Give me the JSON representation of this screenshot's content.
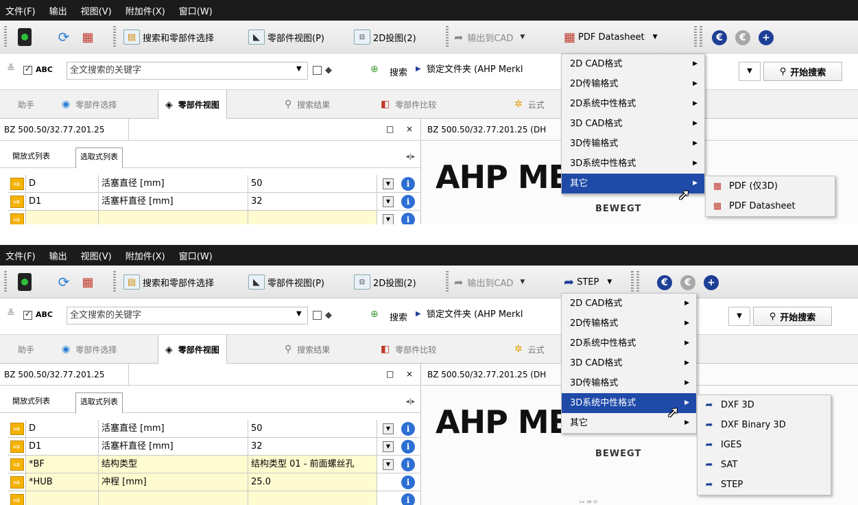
{
  "menubar": {
    "items": [
      "文件(F)",
      "输出",
      "视图(V)",
      "附加件(X)",
      "窗口(W)"
    ]
  },
  "toolbar": {
    "search_select": "搜索和零部件选择",
    "part_view": "零部件视图(P)",
    "projection": "2D投图(2)",
    "export_cad": "输出到CAD"
  },
  "search": {
    "abc_label": "ABC",
    "fulltext_placeholder": "全文搜索的关键字",
    "search_label": "搜索",
    "lock_folder": "锁定文件夹 (AHP Merkl",
    "start_button": "开始搜索"
  },
  "tabs": {
    "assistant": "助手",
    "part_select": "零部件选择",
    "part_view": "零部件视图",
    "search_results": "搜索结果",
    "part_compare": "零部件比较",
    "cloud": "云式"
  },
  "left_panel": {
    "part_number": "BZ 500.50/32.77.201.25",
    "subtab_open": "開放式列表",
    "subtab_select": "选取式列表",
    "max_icon": "□",
    "close_icon": "×"
  },
  "right_panel": {
    "title_top": "BZ 500.50/32.77.201.25 (DH",
    "title_bottom": "BZ 500.50/32.77.201.25 (DH",
    "logo_text": "AHP ME",
    "tagline": "BEWEGT",
    "faint_text": "ᵥᵥ ᵢᵢᵦ ₍₂"
  },
  "top": {
    "format_button": "PDF Datasheet",
    "rows": [
      {
        "code": "D",
        "name": "活塞直径 [mm]",
        "value": "50"
      },
      {
        "code": "D1",
        "name": "活塞杆直径 [mm]",
        "value": "32"
      }
    ],
    "menu": [
      "2D CAD格式",
      "2D传输格式",
      "2D系统中性格式",
      "3D CAD格式",
      "3D传输格式",
      "3D系统中性格式",
      "其它"
    ],
    "highlight": "其它",
    "submenu": [
      "PDF (仅3D)",
      "PDF Datasheet"
    ]
  },
  "bottom": {
    "format_button": "STEP",
    "rows": [
      {
        "code": "D",
        "name": "活塞直径 [mm]",
        "value": "50",
        "yellow": false
      },
      {
        "code": "D1",
        "name": "活塞杆直径 [mm]",
        "value": "32",
        "yellow": false
      },
      {
        "code": "*BF",
        "name": "结构类型",
        "value": "结构类型 01 - 前面螺丝孔",
        "yellow": true
      },
      {
        "code": "*HUB",
        "name": "冲程 [mm]",
        "value": "25.0",
        "yellow": true
      }
    ],
    "menu": [
      "2D CAD格式",
      "2D传输格式",
      "2D系统中性格式",
      "3D CAD格式",
      "3D传输格式",
      "3D系统中性格式",
      "其它"
    ],
    "highlight": "3D系统中性格式",
    "submenu": [
      "DXF 3D",
      "DXF Binary 3D",
      "IGES",
      "SAT",
      "STEP"
    ]
  },
  "colors": {
    "menubar_bg": "#1b1b1b",
    "menu_highlight": "#1f4aa8",
    "row_yellow": "#fffbd0",
    "arrow_orange": "#f5b200",
    "info_blue": "#2d6fd3",
    "euro_blue": "#1d3f96"
  },
  "icons": {
    "traffic_light": "traffic-light-icon",
    "refresh": "refresh-icon",
    "export": "export-icon",
    "euro": "euro-icon",
    "plus": "plus-icon",
    "info": "info-icon"
  }
}
